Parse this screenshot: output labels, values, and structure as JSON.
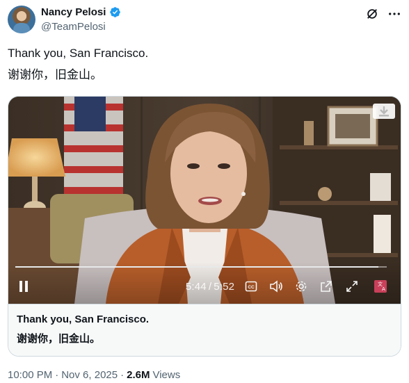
{
  "author": {
    "display_name": "Nancy Pelosi",
    "handle": "@TeamPelosi"
  },
  "tweet": {
    "line1": "Thank you, San Francisco.",
    "line2": "谢谢你，旧金山。"
  },
  "video": {
    "current_time": "5:44",
    "separator": "/",
    "duration": "5:52",
    "progress": 0.977
  },
  "card": {
    "title": "Thank you, San Francisco.",
    "subtitle": "谢谢你，旧金山。"
  },
  "meta": {
    "time": "10:00 PM",
    "dot1": "·",
    "date": "Nov 6, 2025",
    "dot2": "·",
    "views_count": "2.6M",
    "views_label": "Views"
  },
  "colors": {
    "verified": "#1d9bf0",
    "secondary_text": "#536471",
    "border": "#cfd9de"
  },
  "icons": {
    "header": [
      "grok-icon",
      "more-icon"
    ],
    "controls": [
      "pause-icon",
      "closed-captions-icon",
      "volume-icon",
      "settings-icon",
      "pop-out-icon",
      "fullscreen-icon",
      "translate-icon"
    ]
  }
}
